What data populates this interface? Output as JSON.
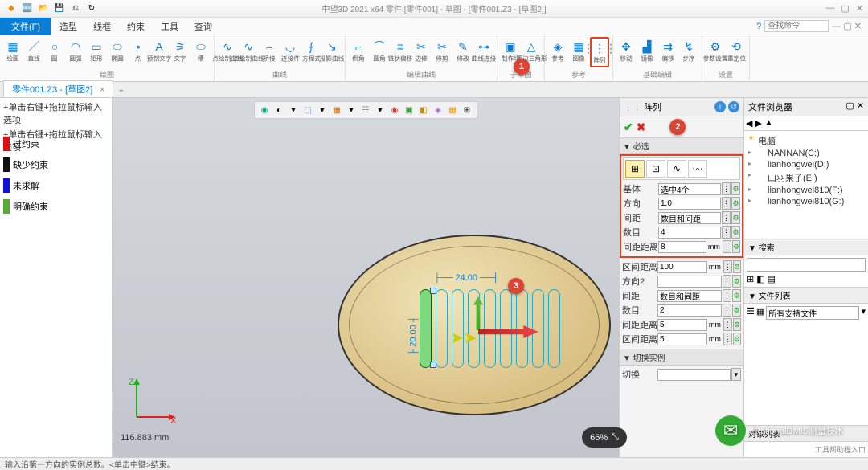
{
  "app": {
    "title_center": "中望3D 2021 x64    零件:[零件001] - 草图 - [零件001.Z3 - [草图2]]",
    "coord_readout": "116.883 mm",
    "status_text": "输入沿第一方向的实例总数。<单击中键>结束。",
    "zoom": "66%",
    "search_placeholder": "查找命令"
  },
  "qat": [
    "🆕",
    "📂",
    "💾",
    "⎌",
    "↻"
  ],
  "menu": {
    "file": "文件(F)",
    "tabs": [
      "造型",
      "线框",
      "约束",
      "工具",
      "查询"
    ],
    "help": "?"
  },
  "ribbon": [
    {
      "name": "绘图",
      "items": [
        {
          "lbl": "绘图",
          "g": "▦"
        },
        {
          "lbl": "直线",
          "g": "／"
        },
        {
          "lbl": "圆",
          "g": "○"
        },
        {
          "lbl": "圆弧",
          "g": "◠"
        },
        {
          "lbl": "矩形",
          "g": "▭"
        },
        {
          "lbl": "椭圆",
          "g": "⬭"
        },
        {
          "lbl": "点",
          "g": "•"
        },
        {
          "lbl": "预制文字",
          "g": "A"
        },
        {
          "lbl": "文字",
          "g": "⚞"
        },
        {
          "lbl": "槽",
          "g": "⬭"
        }
      ]
    },
    {
      "name": "曲线",
      "items": [
        {
          "lbl": "点绘制曲线",
          "g": "∿"
        },
        {
          "lbl": "点绘制曲线",
          "g": "∿"
        },
        {
          "lbl": "桥接",
          "g": "⌢"
        },
        {
          "lbl": "连接件",
          "g": "◡"
        },
        {
          "lbl": "方程式",
          "g": "⨍"
        },
        {
          "lbl": "投影曲线",
          "g": "↘"
        }
      ]
    },
    {
      "name": "编辑曲线",
      "items": [
        {
          "lbl": "倒角",
          "g": "⌐"
        },
        {
          "lbl": "圆角",
          "g": "⌒"
        },
        {
          "lbl": "链状偏移",
          "g": "≡"
        },
        {
          "lbl": "边修",
          "g": "✂"
        },
        {
          "lbl": "修剪",
          "g": "✂"
        },
        {
          "lbl": "修改",
          "g": "✎"
        },
        {
          "lbl": "曲线连接",
          "g": "⊶"
        }
      ]
    },
    {
      "name": "子草图",
      "items": [
        {
          "lbl": "制作块",
          "g": "▣"
        },
        {
          "lbl": "等边三角形",
          "g": "△"
        }
      ]
    },
    {
      "name": "参考",
      "items": [
        {
          "lbl": "参考",
          "g": "◈"
        },
        {
          "lbl": "图像",
          "g": "▦"
        }
      ],
      "extra": [
        {
          "lbl": "阵列",
          "g": "⋮⋮⋮",
          "hl": true
        }
      ]
    },
    {
      "name": "基础编辑",
      "items": [
        {
          "lbl": "移动",
          "g": "✥"
        },
        {
          "lbl": "镜像",
          "g": "▟"
        },
        {
          "lbl": "偏移",
          "g": "⇉"
        },
        {
          "lbl": "步序",
          "g": "↯"
        }
      ]
    },
    {
      "name": "设置",
      "items": [
        {
          "lbl": "参数设置",
          "g": "⚙"
        },
        {
          "lbl": "重定位",
          "g": "⟲"
        }
      ]
    }
  ],
  "doc_tab": {
    "label": "零件001.Z3 - [草图2]"
  },
  "left_tree": [
    "+单击右键+拖拉鼠标输入选项",
    "+单击右键+拖拉鼠标输入选项"
  ],
  "constraints": [
    {
      "c": "#d11",
      "t": "过约束"
    },
    {
      "c": "#111",
      "t": "缺少约束"
    },
    {
      "c": "#11d",
      "t": "未求解"
    },
    {
      "c": "#5a3",
      "t": "明确约束"
    }
  ],
  "dims": {
    "h": "24.00",
    "v": "20.00"
  },
  "badges": {
    "b1": "1",
    "b2": "2",
    "b3": "3"
  },
  "panel": {
    "title": "阵列",
    "sections": {
      "must": "▼ 必选",
      "inst": "▼ 切换实例",
      "other": "切换"
    },
    "modes": [
      "⊞",
      "⊡",
      "∿",
      "〰"
    ],
    "rows": [
      {
        "k": "基体",
        "v": "选中4个",
        "t": "picker"
      },
      {
        "k": "方向",
        "v": "1,0",
        "t": "vec"
      },
      {
        "k": "间距",
        "v": "数目和间距",
        "t": "sel"
      },
      {
        "k": "数目",
        "v": "4",
        "t": "num"
      },
      {
        "k": "间距距离",
        "v": "8",
        "u": "mm",
        "t": "num"
      }
    ],
    "rows2": [
      {
        "k": "区间距离",
        "v": "100",
        "u": "mm",
        "t": "num"
      },
      {
        "k": "方向2",
        "v": "",
        "t": "vec"
      },
      {
        "k": "间距",
        "v": "数目和间距",
        "t": "sel"
      },
      {
        "k": "数目",
        "v": "2",
        "t": "num"
      },
      {
        "k": "间距距离",
        "v": "5",
        "u": "mm",
        "t": "num"
      },
      {
        "k": "区间距离",
        "v": "5",
        "u": "mm",
        "t": "num"
      }
    ]
  },
  "explorer": {
    "title": "文件浏览器",
    "root": "电脑",
    "nodes": [
      "NANNAN(C:)",
      "lianhongwei(D:)",
      "山羽果子(E:)",
      "lianhongwei810(F:)",
      "lianhongwei810(G:)"
    ],
    "search": "▼ 搜索",
    "filelist": "▼ 文件列表",
    "filelist_val": "所有支持文件",
    "bottom": "对象列表",
    "tool": "工具帮助程入口"
  },
  "watermark": "RationalDMIS测量技术",
  "axes": {
    "x": "X",
    "z": "Z"
  }
}
